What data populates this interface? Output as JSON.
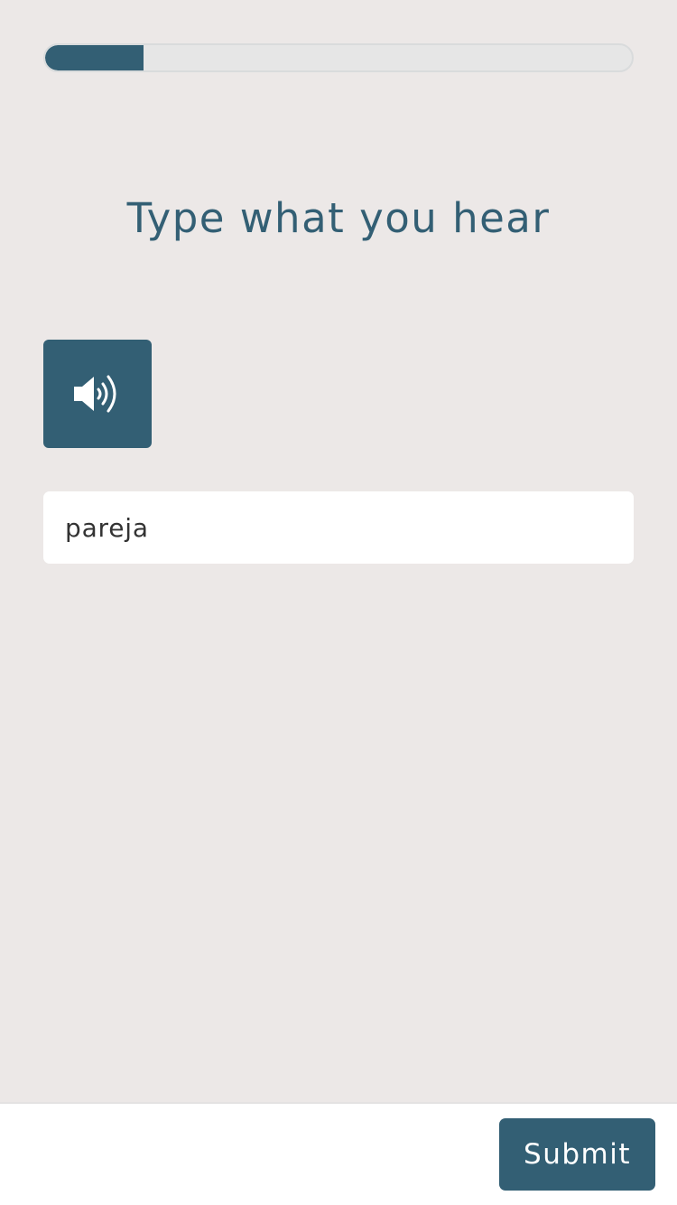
{
  "progress": {
    "fraction": 0.167,
    "fill_color": "#335f74",
    "track_color": "#e6e6e6"
  },
  "prompt": {
    "title": "Type what you hear"
  },
  "audio_button": {
    "icon": "speaker-volume-icon"
  },
  "answer": {
    "value": "pareja",
    "placeholder": ""
  },
  "footer": {
    "submit_label": "Submit"
  },
  "colors": {
    "accent": "#335f74",
    "background": "#ece8e7",
    "surface": "#ffffff"
  }
}
